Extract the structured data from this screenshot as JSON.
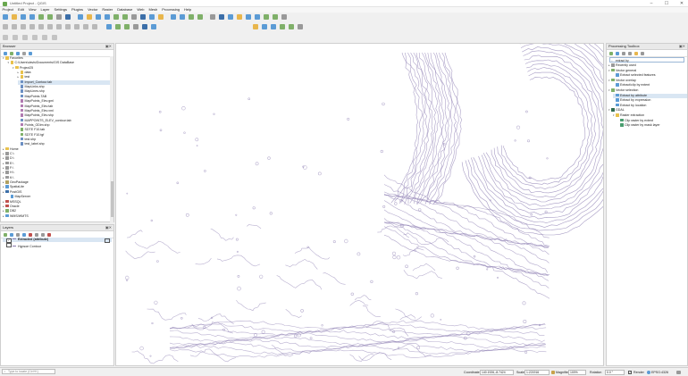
{
  "window": {
    "title": "Untitled Project - QGIS",
    "min": "–",
    "max": "☐",
    "close": "✕"
  },
  "menu": [
    "Project",
    "Edit",
    "View",
    "Layer",
    "Settings",
    "Plugins",
    "Vector",
    "Raster",
    "Database",
    "Web",
    "Mesh",
    "Processing",
    "Help"
  ],
  "browser": {
    "title": "Browser",
    "items": [
      {
        "label": "Favorites",
        "level": 0,
        "icon": "star-icon",
        "expanded": true
      },
      {
        "label": "C:\\Users\\davis\\Documents\\GIS DataBase",
        "level": 1,
        "icon": "folder-icon",
        "expanded": true
      },
      {
        "label": "Project25",
        "level": 2,
        "icon": "folder-icon",
        "expanded": true
      },
      {
        "label": "data",
        "level": 3,
        "icon": "folder-icon",
        "expanded": false
      },
      {
        "label": "test",
        "level": 3,
        "icon": "folder-icon",
        "expanded": false
      },
      {
        "label": "Import_Contour.tab",
        "level": 3,
        "icon": "layer-icon",
        "selected": true
      },
      {
        "label": "MapLinks.shp",
        "level": 3,
        "icon": "layer-icon"
      },
      {
        "label": "MapLines.shp",
        "level": 3,
        "icon": "layer-icon"
      },
      {
        "label": "MapPoints.TAB",
        "level": 3,
        "icon": "layer-icon"
      },
      {
        "label": "MapPoints_Elev.gml",
        "level": 3,
        "icon": "point-layer-icon"
      },
      {
        "label": "MapPoints_Elev.tab",
        "level": 3,
        "icon": "point-layer-icon"
      },
      {
        "label": "MapPoints_Elev.xml",
        "level": 3,
        "icon": "point-layer-icon"
      },
      {
        "label": "MapPoints_Elev.shp",
        "level": 3,
        "icon": "point-layer-icon"
      },
      {
        "label": "MAPPOINTS_ELEV_contour.tab",
        "level": 3,
        "icon": "layer-icon"
      },
      {
        "label": "Points_ODim.shp",
        "level": 3,
        "icon": "point-layer-icon"
      },
      {
        "label": "SDTE F10.tab",
        "level": 3,
        "icon": "raster-icon"
      },
      {
        "label": "SDTE F10.tgf",
        "level": 3,
        "icon": "raster-icon"
      },
      {
        "label": "test.shp",
        "level": 3,
        "icon": "layer-icon"
      },
      {
        "label": "test_label.shp",
        "level": 3,
        "icon": "layer-icon"
      },
      {
        "label": "Home",
        "level": 0,
        "icon": "folder-icon",
        "expanded": false
      },
      {
        "label": "C:\\",
        "level": 0,
        "icon": "drive-icon",
        "expanded": false
      },
      {
        "label": "D:\\",
        "level": 0,
        "icon": "drive-icon",
        "expanded": false
      },
      {
        "label": "E:\\",
        "level": 0,
        "icon": "drive-icon",
        "expanded": false
      },
      {
        "label": "F:\\",
        "level": 0,
        "icon": "drive-icon",
        "expanded": false
      },
      {
        "label": "H:\\",
        "level": 0,
        "icon": "drive-icon",
        "expanded": false
      },
      {
        "label": "K:\\",
        "level": 0,
        "icon": "drive-icon",
        "expanded": false
      },
      {
        "label": "GeoPackage",
        "level": 0,
        "icon": "geopackage-icon",
        "expanded": false
      },
      {
        "label": "SpatiaLite",
        "level": 0,
        "icon": "spatialite-icon",
        "expanded": false
      },
      {
        "label": "PostGIS",
        "level": 0,
        "icon": "postgis-icon",
        "expanded": false
      },
      {
        "label": "MapServer",
        "level": 1,
        "icon": "mapserver-icon"
      },
      {
        "label": "MSSQL",
        "level": 0,
        "icon": "mssql-icon",
        "expanded": false
      },
      {
        "label": "Oracle",
        "level": 0,
        "icon": "oracle-icon",
        "expanded": false
      },
      {
        "label": "DB2",
        "level": 0,
        "icon": "db2-icon",
        "expanded": false
      },
      {
        "label": "WMS/WMTS",
        "level": 0,
        "icon": "wms-icon",
        "expanded": false
      }
    ]
  },
  "layers": {
    "title": "Layers",
    "items": [
      {
        "label": "Extracted (attribute)",
        "checked": true,
        "bold": true
      },
      {
        "label": "Hypsoe Contour",
        "checked": false,
        "bold": false
      }
    ]
  },
  "toolbox": {
    "title": "Processing Toolbox",
    "search_value": "extract by",
    "items": [
      {
        "label": "Recently used",
        "level": 0,
        "type": "group",
        "icon": "clock-icon"
      },
      {
        "label": "Vector general",
        "level": 0,
        "type": "group",
        "icon": "vector-icon",
        "expanded": true
      },
      {
        "label": "Extract selected features",
        "level": 1,
        "type": "alg",
        "icon": "algorithm-icon"
      },
      {
        "label": "Vector overlay",
        "level": 0,
        "type": "group",
        "icon": "vector-icon",
        "expanded": true
      },
      {
        "label": "Extract/clip by extent",
        "level": 1,
        "type": "alg",
        "icon": "algorithm-icon"
      },
      {
        "label": "Vector selection",
        "level": 0,
        "type": "group",
        "icon": "vector-icon",
        "expanded": true
      },
      {
        "label": "Extract by attribute",
        "level": 1,
        "type": "alg",
        "icon": "algorithm-icon",
        "selected": true
      },
      {
        "label": "Extract by expression",
        "level": 1,
        "type": "alg",
        "icon": "algorithm-icon"
      },
      {
        "label": "Extract by location",
        "level": 1,
        "type": "alg",
        "icon": "algorithm-icon"
      },
      {
        "label": "GDAL",
        "level": 0,
        "type": "group",
        "icon": "gdal-icon",
        "expanded": true
      },
      {
        "label": "Raster extraction",
        "level": 1,
        "type": "group",
        "icon": "folder-icon",
        "expanded": true
      },
      {
        "label": "Clip raster by extent",
        "level": 2,
        "type": "alg",
        "icon": "gdal-alg-icon"
      },
      {
        "label": "Clip raster by mask layer",
        "level": 2,
        "type": "alg",
        "icon": "gdal-alg-icon"
      }
    ]
  },
  "status": {
    "search_placeholder": "Type to locate (Ctrl+K)",
    "coordinate_label": "Coordinate",
    "coordinate_value": "140.1926,-8.7424",
    "scale_label": "Scale",
    "scale_value": "1:221916",
    "magnifier_label": "Magnifier",
    "magnifier_value": "100%",
    "rotation_label": "Rotation",
    "rotation_value": "0.0 °",
    "render_label": "Render",
    "crs_label": "EPSG:4326"
  },
  "colors": {
    "contour": "#8a7bb0",
    "accent": "#3b6ea8",
    "panel_header": "#e9e9e9"
  }
}
